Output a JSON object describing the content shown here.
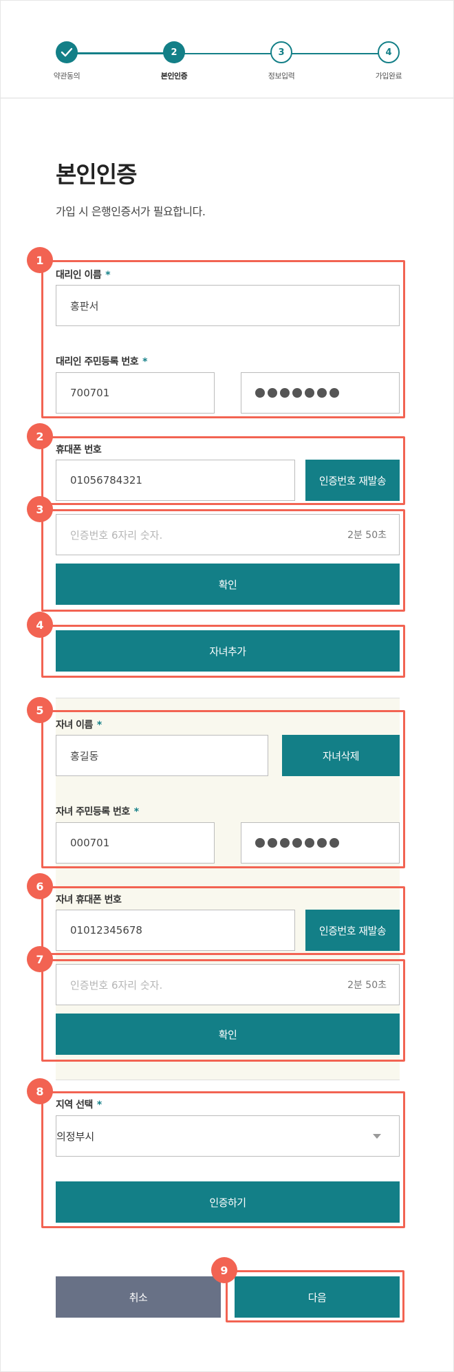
{
  "stepper": {
    "steps": [
      {
        "num": "",
        "label": "약관동의"
      },
      {
        "num": "2",
        "label": "본인인증"
      },
      {
        "num": "3",
        "label": "정보입력"
      },
      {
        "num": "4",
        "label": "가입완료"
      }
    ],
    "accent": "#137f87"
  },
  "header": {
    "title": "본인인증",
    "desc": "가입 시 은행인증서가 필요합니다."
  },
  "badges": [
    "1",
    "2",
    "3",
    "4",
    "5",
    "6",
    "7",
    "8",
    "9"
  ],
  "guardian": {
    "name_label": "대리인 이름",
    "name_value": "홍판서",
    "rrn_label": "대리인 주민등록 번호",
    "rrn_front": "700701",
    "phone_label": "휴대폰 번호",
    "phone_value": "01056784321",
    "resend_label": "인증번호 재발송",
    "code_placeholder": "인증번호 6자리 숫자.",
    "timer": "2분 50초",
    "confirm_label": "확인"
  },
  "add_child_label": "자녀추가",
  "child": {
    "name_label": "자녀 이름",
    "name_value": "홍길동",
    "delete_label": "자녀삭제",
    "rrn_label": "자녀 주민등록 번호",
    "rrn_front": "000701",
    "phone_label": "자녀 휴대폰 번호",
    "phone_value": "01012345678",
    "resend_label": "인증번호 재발송",
    "code_placeholder": "인증번호 6자리 숫자.",
    "timer": "2분 50초",
    "confirm_label": "확인"
  },
  "region": {
    "label": "지역 선택",
    "value": "의정부시",
    "auth_label": "인증하기"
  },
  "required_mark": "*",
  "footer": {
    "cancel_label": "취소",
    "next_label": "다음"
  },
  "colors": {
    "accent": "#137f87",
    "annotation": "#f26352",
    "cancel": "#687186",
    "child_bg": "#f9f8ee"
  }
}
